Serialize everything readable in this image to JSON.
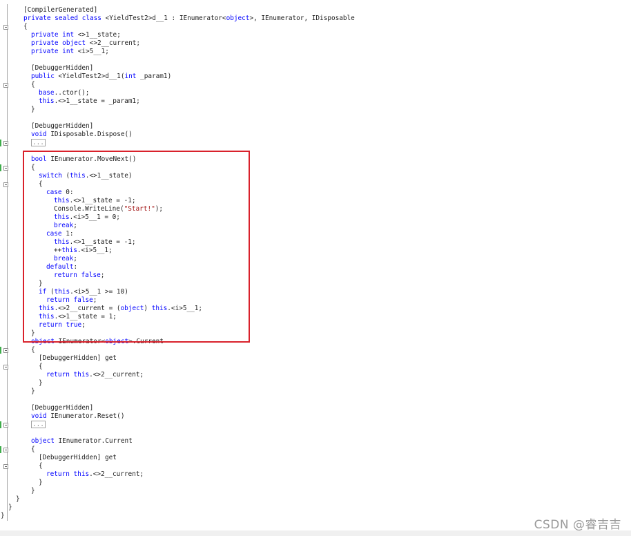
{
  "watermark": "CSDN @睿吉吉",
  "lines": [
    {
      "t": "[CompilerGenerated]",
      "i": 0
    },
    {
      "t": "private sealed class <YieldTest2>d__1 : IEnumerator<object>, IEnumerator, IDisposable",
      "i": 0
    },
    {
      "t": "{",
      "i": 0
    },
    {
      "t": "private int <>1__state;",
      "i": 1
    },
    {
      "t": "private object <>2__current;",
      "i": 1
    },
    {
      "t": "private int <i>5__1;",
      "i": 1
    },
    {
      "t": "",
      "i": 0
    },
    {
      "t": "[DebuggerHidden]",
      "i": 1
    },
    {
      "t": "public <YieldTest2>d__1(int _param1)",
      "i": 1
    },
    {
      "t": "{",
      "i": 1
    },
    {
      "t": "base..ctor();",
      "i": 2
    },
    {
      "t": "this.<>1__state = _param1;",
      "i": 2
    },
    {
      "t": "}",
      "i": 1
    },
    {
      "t": "",
      "i": 0
    },
    {
      "t": "[DebuggerHidden]",
      "i": 1
    },
    {
      "t": "void IDisposable.Dispose()",
      "i": 1
    },
    {
      "t": "...",
      "i": 1
    },
    {
      "t": "",
      "i": 0
    },
    {
      "t": "bool IEnumerator.MoveNext()",
      "i": 1
    },
    {
      "t": "{",
      "i": 1
    },
    {
      "t": "switch (this.<>1__state)",
      "i": 2
    },
    {
      "t": "{",
      "i": 2
    },
    {
      "t": "case 0:",
      "i": 3
    },
    {
      "t": "this.<>1__state = -1;",
      "i": 4
    },
    {
      "t": "Console.WriteLine(\"Start!\");",
      "i": 4
    },
    {
      "t": "this.<i>5__1 = 0;",
      "i": 4
    },
    {
      "t": "break;",
      "i": 4
    },
    {
      "t": "case 1:",
      "i": 3
    },
    {
      "t": "this.<>1__state = -1;",
      "i": 4
    },
    {
      "t": "++this.<i>5__1;",
      "i": 4
    },
    {
      "t": "break;",
      "i": 4
    },
    {
      "t": "default:",
      "i": 3
    },
    {
      "t": "return false;",
      "i": 4
    },
    {
      "t": "}",
      "i": 2
    },
    {
      "t": "if (this.<i>5__1 >= 10)",
      "i": 2
    },
    {
      "t": "return false;",
      "i": 3
    },
    {
      "t": "this.<>2__current = (object) this.<i>5__1;",
      "i": 2
    },
    {
      "t": "this.<>1__state = 1;",
      "i": 2
    },
    {
      "t": "return true;",
      "i": 2
    },
    {
      "t": "}",
      "i": 1
    },
    {
      "t": "object IEnumerator<object>.Current",
      "i": 1
    },
    {
      "t": "{",
      "i": 1
    },
    {
      "t": "[DebuggerHidden] get",
      "i": 2
    },
    {
      "t": "{",
      "i": 2
    },
    {
      "t": "return this.<>2__current;",
      "i": 3
    },
    {
      "t": "}",
      "i": 2
    },
    {
      "t": "}",
      "i": 1
    },
    {
      "t": "",
      "i": 0
    },
    {
      "t": "[DebuggerHidden]",
      "i": 1
    },
    {
      "t": "void IEnumerator.Reset()",
      "i": 1
    },
    {
      "t": "...",
      "i": 1
    },
    {
      "t": "",
      "i": 0
    },
    {
      "t": "object IEnumerator.Current",
      "i": 1
    },
    {
      "t": "{",
      "i": 1
    },
    {
      "t": "[DebuggerHidden] get",
      "i": 2
    },
    {
      "t": "{",
      "i": 2
    },
    {
      "t": "return this.<>2__current;",
      "i": 3
    },
    {
      "t": "}",
      "i": 2
    },
    {
      "t": "}",
      "i": 1
    },
    {
      "t": "}",
      "i": -1
    },
    {
      "t": "}",
      "i": -2
    },
    {
      "t": "}",
      "i": -3
    }
  ],
  "keywords": [
    "private",
    "sealed",
    "class",
    "object",
    "int",
    "public",
    "void",
    "bool",
    "switch",
    "case",
    "this",
    "break",
    "default",
    "return",
    "false",
    "true",
    "if",
    "base"
  ]
}
